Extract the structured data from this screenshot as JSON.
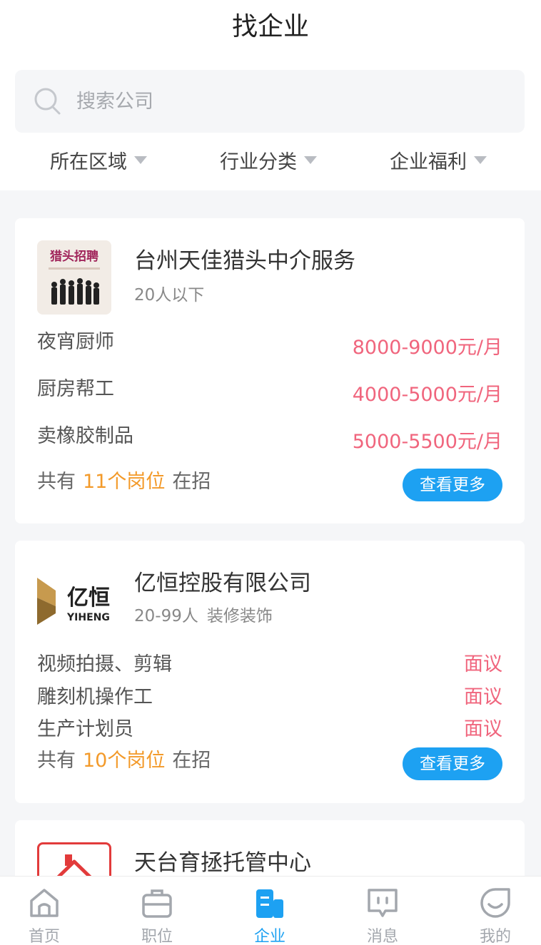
{
  "header": {
    "title": "找企业"
  },
  "search": {
    "placeholder": "搜索公司"
  },
  "filters": [
    {
      "label": "所在区域"
    },
    {
      "label": "行业分类"
    },
    {
      "label": "企业福利"
    }
  ],
  "companies": [
    {
      "name": "台州天佳猎头中介服务",
      "size": "20人以下",
      "industry": "",
      "logo_text": "猎头招聘",
      "jobs": [
        {
          "title": "夜宵厨师",
          "salary": "8000-9000元/月"
        },
        {
          "title": "厨房帮工",
          "salary": "4000-5000元/月"
        },
        {
          "title": "卖橡胶制品",
          "salary": "5000-5500元/月"
        }
      ],
      "count_prefix": "共有",
      "count_value": "11个岗位",
      "count_suffix": "在招",
      "more_label": "查看更多"
    },
    {
      "name": "亿恒控股有限公司",
      "size": "20-99人",
      "industry": "装修装饰",
      "logo_text": "亿恒",
      "logo_sub": "YIHENG",
      "jobs": [
        {
          "title": "视频拍摄、剪辑",
          "salary": "面议"
        },
        {
          "title": "雕刻机操作工",
          "salary": "面议"
        },
        {
          "title": "生产计划员",
          "salary": "面议"
        }
      ],
      "count_prefix": "共有",
      "count_value": "10个岗位",
      "count_suffix": "在招",
      "more_label": "查看更多"
    },
    {
      "name": "天台育拯托管中心"
    }
  ],
  "tabbar": [
    {
      "label": "首页",
      "icon": "home-icon"
    },
    {
      "label": "职位",
      "icon": "briefcase-icon"
    },
    {
      "label": "企业",
      "icon": "building-icon",
      "active": true
    },
    {
      "label": "消息",
      "icon": "message-icon"
    },
    {
      "label": "我的",
      "icon": "profile-icon"
    }
  ],
  "colors": {
    "accent": "#1da1f2",
    "salary": "#f0657d",
    "highlight": "#f39a2a"
  }
}
